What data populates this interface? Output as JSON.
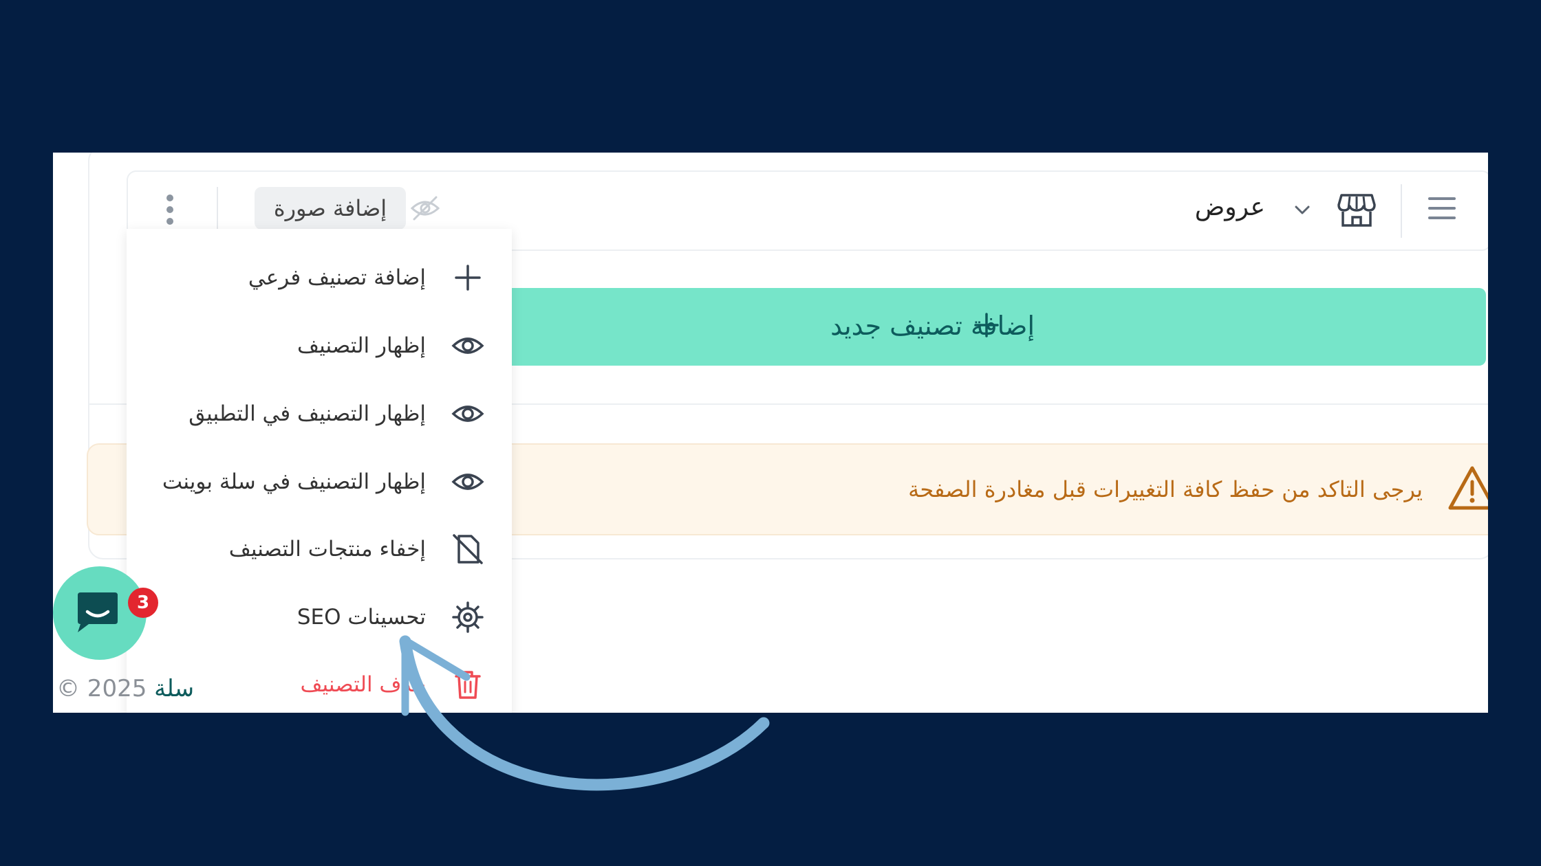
{
  "category": {
    "name": "عروض",
    "add_image_label": "إضافة صورة"
  },
  "add_category_button": {
    "label": "إضافة تصنيف جديد"
  },
  "warning": {
    "text": "يرجى التاكد من حفظ كافة التغييرات قبل مغادرة الصفحة"
  },
  "menu": {
    "items": [
      {
        "label": "إضافة تصنيف فرعي",
        "icon": "plus-icon"
      },
      {
        "label": "إظهار التصنيف",
        "icon": "eye-icon"
      },
      {
        "label": "إظهار التصنيف في التطبيق",
        "icon": "eye-icon"
      },
      {
        "label": "إظهار التصنيف في سلة بوينت",
        "icon": "eye-icon"
      },
      {
        "label": "إخفاء منتجات التصنيف",
        "icon": "file-off-icon"
      },
      {
        "label": "تحسينات SEO",
        "icon": "gear-icon"
      },
      {
        "label": "حذف التصنيف",
        "icon": "trash-icon"
      }
    ]
  },
  "chat": {
    "badge_count": "3"
  },
  "footer": {
    "brand": "سلة",
    "copyright": "© 2025"
  },
  "colors": {
    "background": "#041e42",
    "accent_green": "#76e5c9",
    "accent_text": "#0d5b5c",
    "warning_text": "#b86a16",
    "danger": "#ef4b54",
    "annotation_arrow": "#7bb0d6"
  }
}
